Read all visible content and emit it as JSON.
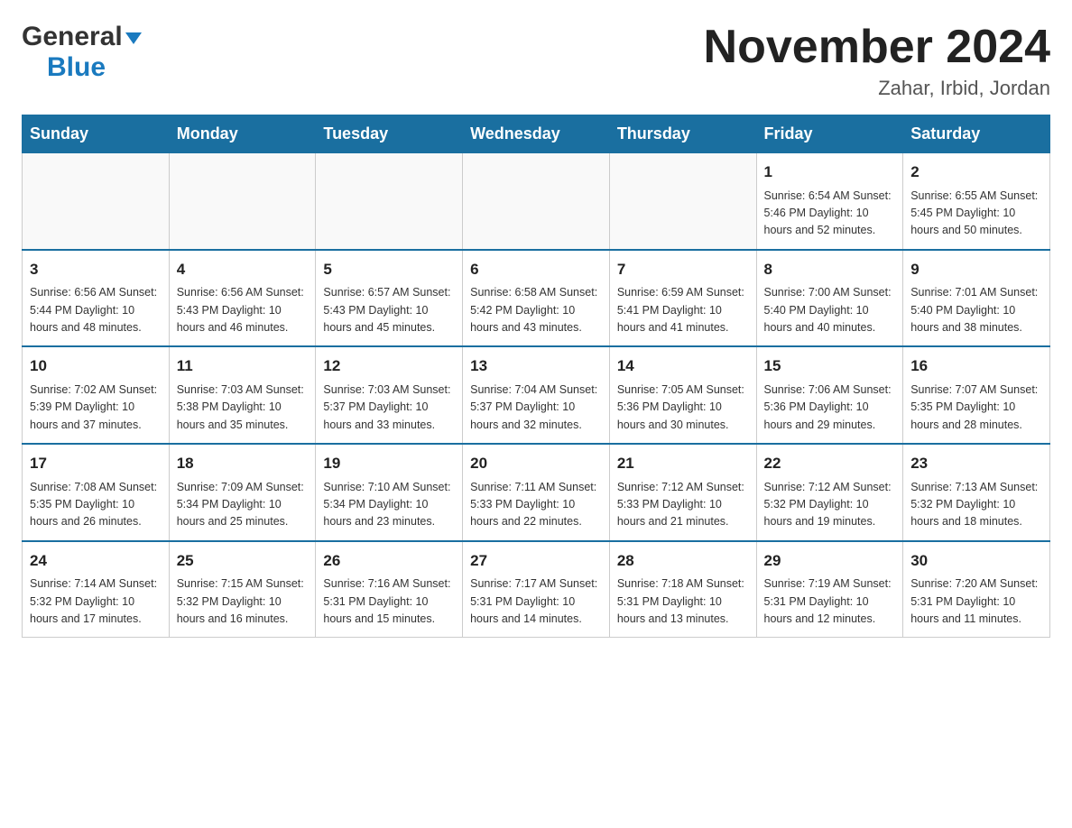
{
  "header": {
    "logo_general": "General",
    "logo_blue": "Blue",
    "month_title": "November 2024",
    "location": "Zahar, Irbid, Jordan"
  },
  "days_of_week": [
    "Sunday",
    "Monday",
    "Tuesday",
    "Wednesday",
    "Thursday",
    "Friday",
    "Saturday"
  ],
  "weeks": [
    [
      {
        "day": "",
        "info": ""
      },
      {
        "day": "",
        "info": ""
      },
      {
        "day": "",
        "info": ""
      },
      {
        "day": "",
        "info": ""
      },
      {
        "day": "",
        "info": ""
      },
      {
        "day": "1",
        "info": "Sunrise: 6:54 AM\nSunset: 5:46 PM\nDaylight: 10 hours\nand 52 minutes."
      },
      {
        "day": "2",
        "info": "Sunrise: 6:55 AM\nSunset: 5:45 PM\nDaylight: 10 hours\nand 50 minutes."
      }
    ],
    [
      {
        "day": "3",
        "info": "Sunrise: 6:56 AM\nSunset: 5:44 PM\nDaylight: 10 hours\nand 48 minutes."
      },
      {
        "day": "4",
        "info": "Sunrise: 6:56 AM\nSunset: 5:43 PM\nDaylight: 10 hours\nand 46 minutes."
      },
      {
        "day": "5",
        "info": "Sunrise: 6:57 AM\nSunset: 5:43 PM\nDaylight: 10 hours\nand 45 minutes."
      },
      {
        "day": "6",
        "info": "Sunrise: 6:58 AM\nSunset: 5:42 PM\nDaylight: 10 hours\nand 43 minutes."
      },
      {
        "day": "7",
        "info": "Sunrise: 6:59 AM\nSunset: 5:41 PM\nDaylight: 10 hours\nand 41 minutes."
      },
      {
        "day": "8",
        "info": "Sunrise: 7:00 AM\nSunset: 5:40 PM\nDaylight: 10 hours\nand 40 minutes."
      },
      {
        "day": "9",
        "info": "Sunrise: 7:01 AM\nSunset: 5:40 PM\nDaylight: 10 hours\nand 38 minutes."
      }
    ],
    [
      {
        "day": "10",
        "info": "Sunrise: 7:02 AM\nSunset: 5:39 PM\nDaylight: 10 hours\nand 37 minutes."
      },
      {
        "day": "11",
        "info": "Sunrise: 7:03 AM\nSunset: 5:38 PM\nDaylight: 10 hours\nand 35 minutes."
      },
      {
        "day": "12",
        "info": "Sunrise: 7:03 AM\nSunset: 5:37 PM\nDaylight: 10 hours\nand 33 minutes."
      },
      {
        "day": "13",
        "info": "Sunrise: 7:04 AM\nSunset: 5:37 PM\nDaylight: 10 hours\nand 32 minutes."
      },
      {
        "day": "14",
        "info": "Sunrise: 7:05 AM\nSunset: 5:36 PM\nDaylight: 10 hours\nand 30 minutes."
      },
      {
        "day": "15",
        "info": "Sunrise: 7:06 AM\nSunset: 5:36 PM\nDaylight: 10 hours\nand 29 minutes."
      },
      {
        "day": "16",
        "info": "Sunrise: 7:07 AM\nSunset: 5:35 PM\nDaylight: 10 hours\nand 28 minutes."
      }
    ],
    [
      {
        "day": "17",
        "info": "Sunrise: 7:08 AM\nSunset: 5:35 PM\nDaylight: 10 hours\nand 26 minutes."
      },
      {
        "day": "18",
        "info": "Sunrise: 7:09 AM\nSunset: 5:34 PM\nDaylight: 10 hours\nand 25 minutes."
      },
      {
        "day": "19",
        "info": "Sunrise: 7:10 AM\nSunset: 5:34 PM\nDaylight: 10 hours\nand 23 minutes."
      },
      {
        "day": "20",
        "info": "Sunrise: 7:11 AM\nSunset: 5:33 PM\nDaylight: 10 hours\nand 22 minutes."
      },
      {
        "day": "21",
        "info": "Sunrise: 7:12 AM\nSunset: 5:33 PM\nDaylight: 10 hours\nand 21 minutes."
      },
      {
        "day": "22",
        "info": "Sunrise: 7:12 AM\nSunset: 5:32 PM\nDaylight: 10 hours\nand 19 minutes."
      },
      {
        "day": "23",
        "info": "Sunrise: 7:13 AM\nSunset: 5:32 PM\nDaylight: 10 hours\nand 18 minutes."
      }
    ],
    [
      {
        "day": "24",
        "info": "Sunrise: 7:14 AM\nSunset: 5:32 PM\nDaylight: 10 hours\nand 17 minutes."
      },
      {
        "day": "25",
        "info": "Sunrise: 7:15 AM\nSunset: 5:32 PM\nDaylight: 10 hours\nand 16 minutes."
      },
      {
        "day": "26",
        "info": "Sunrise: 7:16 AM\nSunset: 5:31 PM\nDaylight: 10 hours\nand 15 minutes."
      },
      {
        "day": "27",
        "info": "Sunrise: 7:17 AM\nSunset: 5:31 PM\nDaylight: 10 hours\nand 14 minutes."
      },
      {
        "day": "28",
        "info": "Sunrise: 7:18 AM\nSunset: 5:31 PM\nDaylight: 10 hours\nand 13 minutes."
      },
      {
        "day": "29",
        "info": "Sunrise: 7:19 AM\nSunset: 5:31 PM\nDaylight: 10 hours\nand 12 minutes."
      },
      {
        "day": "30",
        "info": "Sunrise: 7:20 AM\nSunset: 5:31 PM\nDaylight: 10 hours\nand 11 minutes."
      }
    ]
  ]
}
